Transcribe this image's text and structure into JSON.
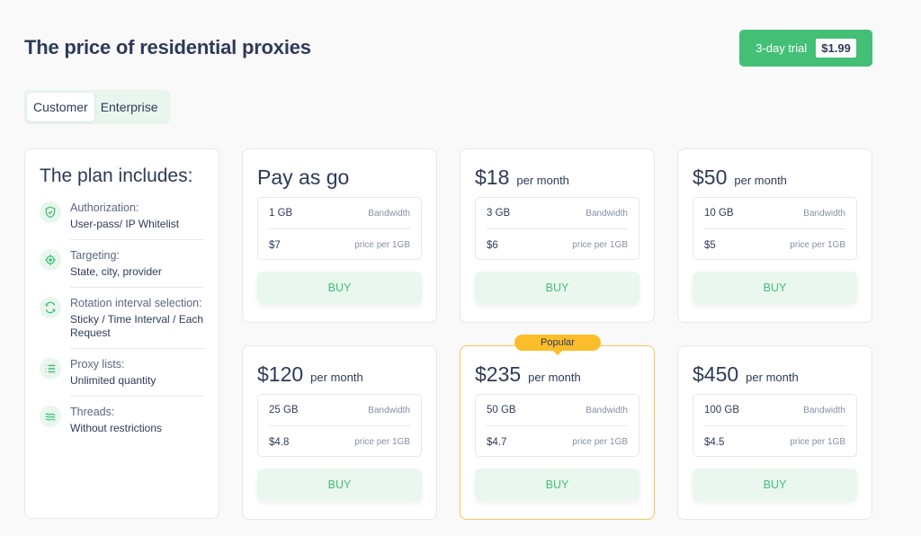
{
  "header": {
    "title": "The price of residential proxies",
    "trial_label": "3-day trial",
    "trial_price": "$1.99"
  },
  "tabs": [
    {
      "label": "Customer",
      "active": true
    },
    {
      "label": "Enterprise",
      "active": false
    }
  ],
  "includes": {
    "title": "The plan includes:",
    "features": [
      {
        "icon": "shield-check-icon",
        "label": "Authorization:",
        "value": "User-pass/ IP Whitelist"
      },
      {
        "icon": "crosshair-icon",
        "label": "Targeting:",
        "value": "State, city, provider"
      },
      {
        "icon": "refresh-icon",
        "label": "Rotation interval selection:",
        "value": "Sticky / Time Interval / Each Request"
      },
      {
        "icon": "list-icon",
        "label": "Proxy lists:",
        "value": "Unlimited quantity"
      },
      {
        "icon": "waves-icon",
        "label": "Threads:",
        "value": "Without restrictions"
      }
    ]
  },
  "plans": [
    {
      "price": "Pay as go",
      "period": "",
      "bandwidth": "1 GB",
      "bandwidth_label": "Bandwidth",
      "per_gb": "$7",
      "per_gb_label": "price per 1GB",
      "buy": "BUY"
    },
    {
      "price": "$18",
      "period": "per month",
      "bandwidth": "3 GB",
      "bandwidth_label": "Bandwidth",
      "per_gb": "$6",
      "per_gb_label": "price per 1GB",
      "buy": "BUY"
    },
    {
      "price": "$50",
      "period": "per month",
      "bandwidth": "10 GB",
      "bandwidth_label": "Bandwidth",
      "per_gb": "$5",
      "per_gb_label": "price per 1GB",
      "buy": "BUY"
    },
    {
      "price": "$120",
      "period": "per month",
      "bandwidth": "25 GB",
      "bandwidth_label": "Bandwidth",
      "per_gb": "$4.8",
      "per_gb_label": "price per 1GB",
      "buy": "BUY"
    },
    {
      "price": "$235",
      "period": "per month",
      "bandwidth": "50 GB",
      "bandwidth_label": "Bandwidth",
      "per_gb": "$4.7",
      "per_gb_label": "price per 1GB",
      "buy": "BUY",
      "badge": "Popular"
    },
    {
      "price": "$450",
      "period": "per month",
      "bandwidth": "100 GB",
      "bandwidth_label": "Bandwidth",
      "per_gb": "$4.5",
      "per_gb_label": "price per 1GB",
      "buy": "BUY"
    }
  ],
  "colors": {
    "accent_green": "#43c076",
    "popular_yellow": "#fbbd2a",
    "text_dark": "#2d3b58"
  }
}
